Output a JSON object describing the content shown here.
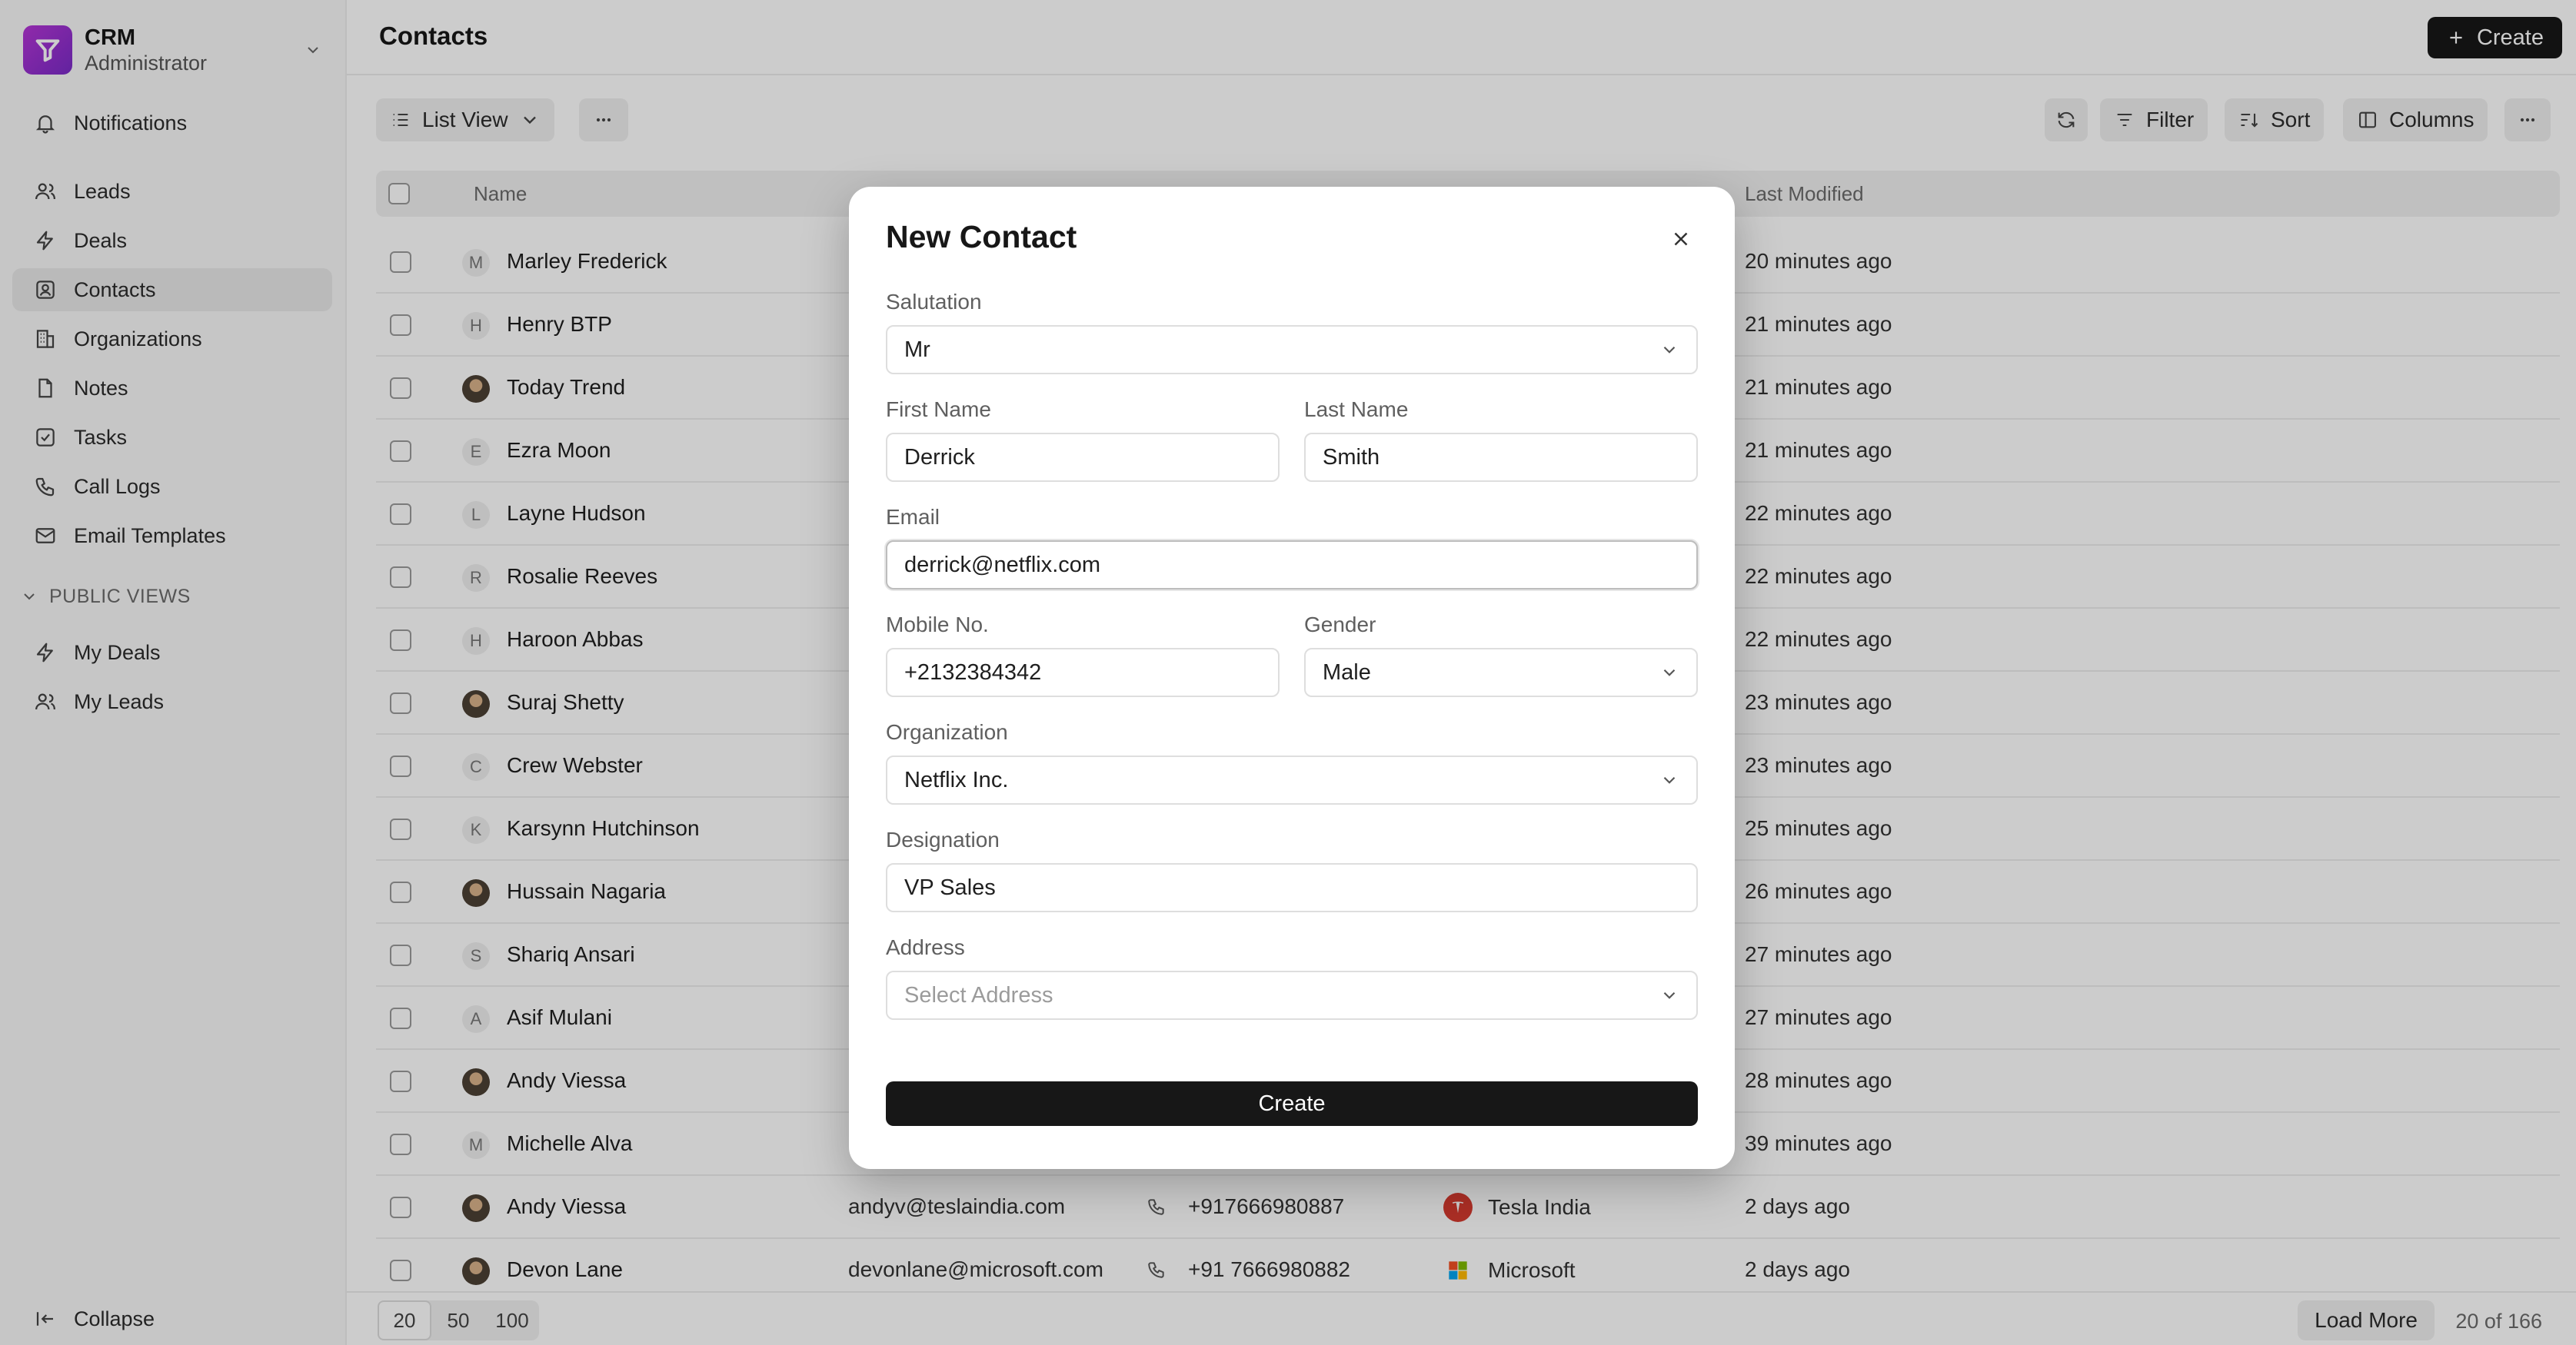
{
  "brand": {
    "name": "CRM",
    "role": "Administrator"
  },
  "sidebar": {
    "notifications": "Notifications",
    "items": [
      {
        "label": "Leads",
        "icon": "users-icon"
      },
      {
        "label": "Deals",
        "icon": "activity-icon"
      },
      {
        "label": "Contacts",
        "icon": "contact-icon"
      },
      {
        "label": "Organizations",
        "icon": "building-icon"
      },
      {
        "label": "Notes",
        "icon": "file-icon"
      },
      {
        "label": "Tasks",
        "icon": "check-square-icon"
      },
      {
        "label": "Call Logs",
        "icon": "phone-icon"
      },
      {
        "label": "Email Templates",
        "icon": "mail-icon"
      }
    ],
    "section_title": "PUBLIC VIEWS",
    "public_views": [
      {
        "label": "My Deals",
        "icon": "activity-icon"
      },
      {
        "label": "My Leads",
        "icon": "users-icon"
      }
    ],
    "collapse": "Collapse"
  },
  "header": {
    "title": "Contacts",
    "create_label": "Create"
  },
  "toolbar": {
    "view_label": "List View",
    "filter_label": "Filter",
    "sort_label": "Sort",
    "columns_label": "Columns"
  },
  "table": {
    "columns": {
      "name": "Name",
      "last_modified": "Last Modified"
    },
    "rows": [
      {
        "initial": "M",
        "name": "Marley Frederick",
        "modified": "20 minutes ago"
      },
      {
        "initial": "H",
        "name": "Henry BTP",
        "modified": "21 minutes ago"
      },
      {
        "initial": "",
        "name": "Today Trend",
        "modified": "21 minutes ago"
      },
      {
        "initial": "E",
        "name": "Ezra Moon",
        "modified": "21 minutes ago"
      },
      {
        "initial": "L",
        "name": "Layne Hudson",
        "modified": "22 minutes ago"
      },
      {
        "initial": "R",
        "name": "Rosalie Reeves",
        "modified": "22 minutes ago"
      },
      {
        "initial": "H",
        "name": "Haroon Abbas",
        "modified": "22 minutes ago"
      },
      {
        "initial": "",
        "name": "Suraj Shetty",
        "modified": "23 minutes ago"
      },
      {
        "initial": "C",
        "name": "Crew Webster",
        "modified": "23 minutes ago"
      },
      {
        "initial": "K",
        "name": "Karsynn Hutchinson",
        "modified": "25 minutes ago"
      },
      {
        "initial": "",
        "name": "Hussain Nagaria",
        "modified": "26 minutes ago"
      },
      {
        "initial": "S",
        "name": "Shariq Ansari",
        "modified": "27 minutes ago"
      },
      {
        "initial": "A",
        "name": "Asif Mulani",
        "modified": "27 minutes ago"
      },
      {
        "initial": "",
        "name": "Andy Viessa",
        "modified": "28 minutes ago"
      },
      {
        "initial": "M",
        "name": "Michelle Alva",
        "modified": "39 minutes ago"
      },
      {
        "initial": "",
        "name": "Andy Viessa",
        "email": "andyv@teslaindia.com",
        "phone": "+917666980887",
        "org": "Tesla India",
        "modified": "2 days ago"
      },
      {
        "initial": "",
        "name": "Devon Lane",
        "email": "devonlane@microsoft.com",
        "phone": "+91 7666980882",
        "org": "Microsoft",
        "modified": "2 days ago"
      }
    ]
  },
  "footer": {
    "page_sizes": [
      "20",
      "50",
      "100"
    ],
    "load_more": "Load More",
    "count": "20 of 166"
  },
  "modal": {
    "title": "New Contact",
    "salutation": {
      "label": "Salutation",
      "value": "Mr"
    },
    "first_name": {
      "label": "First Name",
      "value": "Derrick"
    },
    "last_name": {
      "label": "Last Name",
      "value": "Smith"
    },
    "email": {
      "label": "Email",
      "value": "derrick@netflix.com"
    },
    "mobile": {
      "label": "Mobile No.",
      "value": "+2132384342"
    },
    "gender": {
      "label": "Gender",
      "value": "Male"
    },
    "organization": {
      "label": "Organization",
      "value": "Netflix Inc."
    },
    "designation": {
      "label": "Designation",
      "value": "VP Sales"
    },
    "address": {
      "label": "Address",
      "placeholder": "Select Address"
    },
    "submit": "Create"
  },
  "colors": {
    "accent": "#171717",
    "brand": "#a13ad4",
    "tesla": "#d63a2f"
  }
}
